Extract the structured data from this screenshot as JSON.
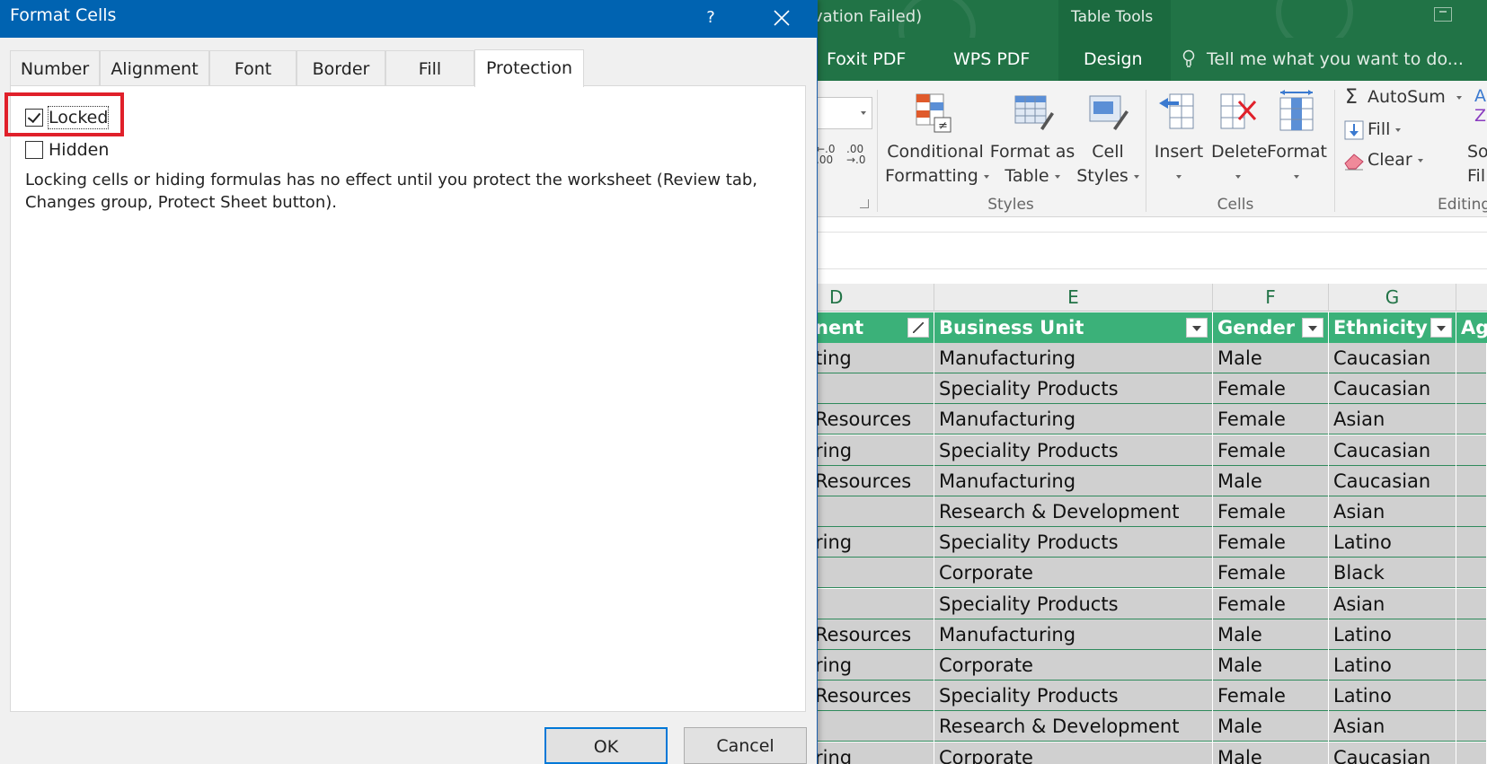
{
  "dialog": {
    "title": "Format Cells",
    "help_label": "?",
    "tabs": [
      {
        "label": "Number"
      },
      {
        "label": "Alignment"
      },
      {
        "label": "Font"
      },
      {
        "label": "Border"
      },
      {
        "label": "Fill"
      },
      {
        "label": "Protection"
      }
    ],
    "active_tab": "Protection",
    "locked": {
      "label": "Locked",
      "checked": true
    },
    "hidden": {
      "label": "Hidden",
      "checked": false
    },
    "note": "Locking cells or hiding formulas has no effect until you protect the worksheet (Review tab, Changes group, Protect Sheet button).",
    "ok_label": "OK",
    "cancel_label": "Cancel"
  },
  "excel": {
    "window_title_fragment": "vation Failed)",
    "context_label": "Table Tools",
    "ribbon_tabs": [
      "Foxit PDF",
      "WPS PDF",
      "Design"
    ],
    "tell_me": "Tell me what you want to do...",
    "ribbon": {
      "decimal_increase": "←.0\n.00",
      "decimal_decrease": ".00\n→.0",
      "conditional_formatting": [
        "Conditional",
        "Formatting"
      ],
      "format_as_table": [
        "Format as",
        "Table"
      ],
      "cell_styles": [
        "Cell",
        "Styles"
      ],
      "styles_group": "Styles",
      "insert": "Insert",
      "delete": "Delete",
      "format": "Format",
      "cells_group": "Cells",
      "autosum": "AutoSum",
      "fill": "Fill",
      "clear": "Clear",
      "editing_group": "Editing",
      "sort_partial": [
        "So",
        "Fil"
      ],
      "az_partial": [
        "A",
        "Z"
      ]
    },
    "columns": [
      "D",
      "E",
      "F",
      "G"
    ],
    "table_headers": [
      "nent",
      "Business Unit",
      "Gender",
      "Ethnicity",
      "Ag"
    ],
    "rows": [
      [
        "ting",
        "Manufacturing",
        "Male",
        "Caucasian"
      ],
      [
        "",
        "Speciality Products",
        "Female",
        "Caucasian"
      ],
      [
        "Resources",
        "Manufacturing",
        "Female",
        "Asian"
      ],
      [
        "ring",
        "Speciality Products",
        "Female",
        "Caucasian"
      ],
      [
        "Resources",
        "Manufacturing",
        "Male",
        "Caucasian"
      ],
      [
        "",
        "Research & Development",
        "Female",
        "Asian"
      ],
      [
        "ring",
        "Speciality Products",
        "Female",
        "Latino"
      ],
      [
        "",
        "Corporate",
        "Female",
        "Black"
      ],
      [
        "",
        "Speciality Products",
        "Female",
        "Asian"
      ],
      [
        "Resources",
        "Manufacturing",
        "Male",
        "Latino"
      ],
      [
        "ring",
        "Corporate",
        "Male",
        "Latino"
      ],
      [
        "Resources",
        "Speciality Products",
        "Female",
        "Latino"
      ],
      [
        "",
        "Research & Development",
        "Male",
        "Asian"
      ],
      [
        "ring",
        "Corporate",
        "Male",
        "Caucasian"
      ]
    ]
  },
  "colors": {
    "excel_green": "#217346",
    "table_header_green": "#3bb179",
    "dialog_blue": "#0063b1",
    "highlight_red": "#e0202a"
  }
}
